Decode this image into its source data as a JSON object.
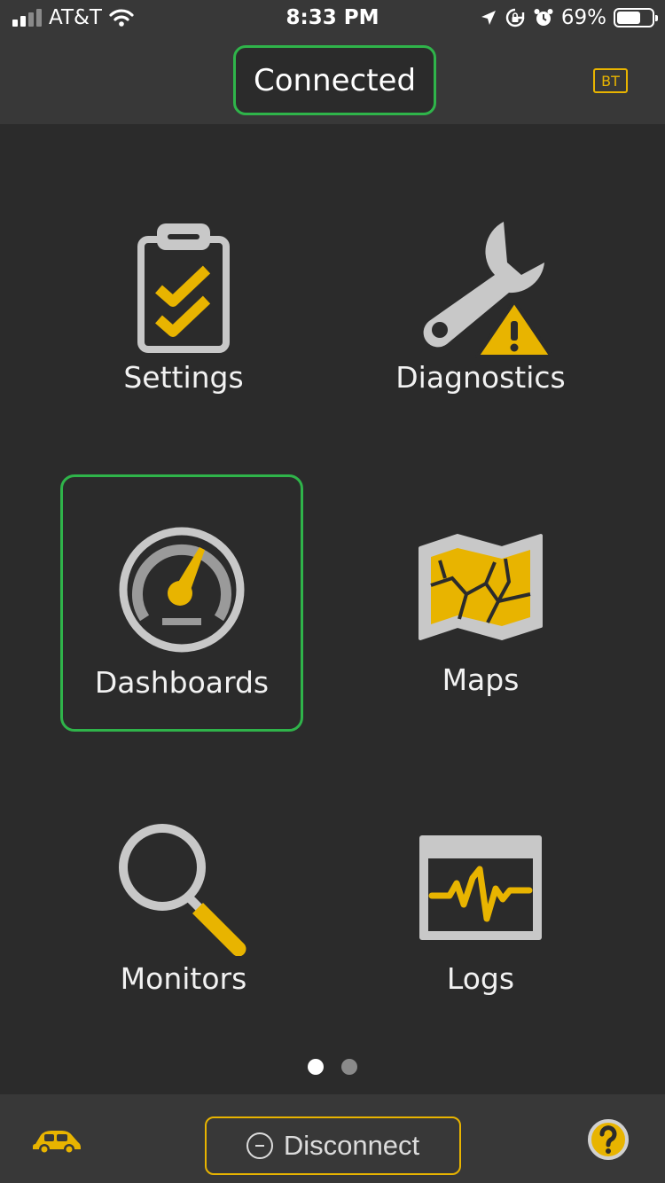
{
  "status_bar": {
    "carrier": "AT&T",
    "time": "8:33 PM",
    "battery_percent": "69%",
    "battery_level": 0.69,
    "icons": [
      "signal-icon",
      "wifi-icon",
      "location-arrow-icon",
      "rotation-lock-icon",
      "alarm-icon",
      "battery-icon"
    ]
  },
  "header": {
    "status": "Connected",
    "bt_label": "BT"
  },
  "menu": {
    "settings": "Settings",
    "diagnostics": "Diagnostics",
    "dashboards": "Dashboards",
    "maps": "Maps",
    "monitors": "Monitors",
    "logs": "Logs"
  },
  "pager": {
    "current_page": 1,
    "total_pages": 2
  },
  "bottom_bar": {
    "disconnect_label": "Disconnect"
  },
  "colors": {
    "accent": "#e8b400",
    "selected": "#2fb44a",
    "background": "#2b2b2b",
    "bar": "#383838",
    "icon_gray": "#c8c8c8"
  }
}
